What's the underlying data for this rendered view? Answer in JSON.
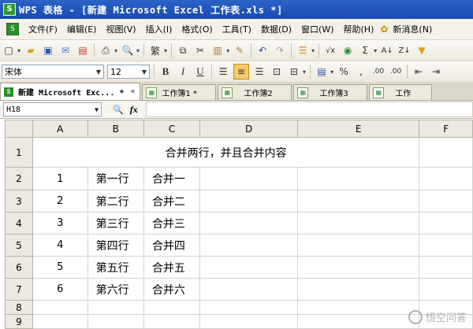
{
  "titlebar": {
    "app_icon": "S",
    "title": "WPS 表格 - [新建 Microsoft Excel 工作表.xls *]"
  },
  "menubar": {
    "doc_icon": "S",
    "items": [
      "文件(F)",
      "编辑(E)",
      "视图(V)",
      "插入(I)",
      "格式(O)",
      "工具(T)",
      "数据(D)",
      "窗口(W)",
      "帮助(H)",
      "新消息(N)"
    ],
    "news_icon": "mascot-icon"
  },
  "toolbar1": {
    "icons": [
      "new-icon",
      "open-icon",
      "save-icon",
      "mail-icon",
      "export-pdf-icon",
      "print-icon",
      "print-preview-icon",
      "traditional-chinese-icon",
      "copy-icon",
      "cut-icon",
      "paste-icon",
      "format-painter-icon",
      "undo-icon",
      "redo-icon",
      "sort-icon",
      "fx-icon",
      "sum-icon",
      "autosum-icon",
      "sort-ascending-icon",
      "sort-descending-icon",
      "filter-icon"
    ],
    "traditional_label": "繁"
  },
  "toolbar2": {
    "font_name": "宋体",
    "font_size": "12",
    "bold": "B",
    "italic": "I",
    "underline": "U",
    "percent": "%",
    "thousands": ",",
    "inc_decimal": ".00",
    "dec_decimal": ".00"
  },
  "tabs": [
    {
      "label": "新建 Microsoft Exc... *",
      "active": true,
      "close": "×"
    },
    {
      "label": "工作簿1 *",
      "active": false
    },
    {
      "label": "工作簿2",
      "active": false
    },
    {
      "label": "工作簿3",
      "active": false
    },
    {
      "label": "工作",
      "active": false
    }
  ],
  "formulabar": {
    "cell_ref": "H18",
    "fx": "fx",
    "content": ""
  },
  "sheet": {
    "columns": [
      "A",
      "B",
      "C",
      "D",
      "E",
      "F"
    ],
    "rows": [
      "1",
      "2",
      "3",
      "4",
      "5",
      "6",
      "7",
      "8",
      "9"
    ],
    "merged_text": "合并两行，并且合并内容",
    "data": [
      {
        "a": "1",
        "b": "第一行",
        "c": "合并一"
      },
      {
        "a": "2",
        "b": "第二行",
        "c": "合并二"
      },
      {
        "a": "3",
        "b": "第三行",
        "c": "合并三"
      },
      {
        "a": "4",
        "b": "第四行",
        "c": "合并四"
      },
      {
        "a": "5",
        "b": "第五行",
        "c": "合并五"
      },
      {
        "a": "6",
        "b": "第六行",
        "c": "合并六"
      }
    ]
  },
  "watermark": "悟空问答"
}
